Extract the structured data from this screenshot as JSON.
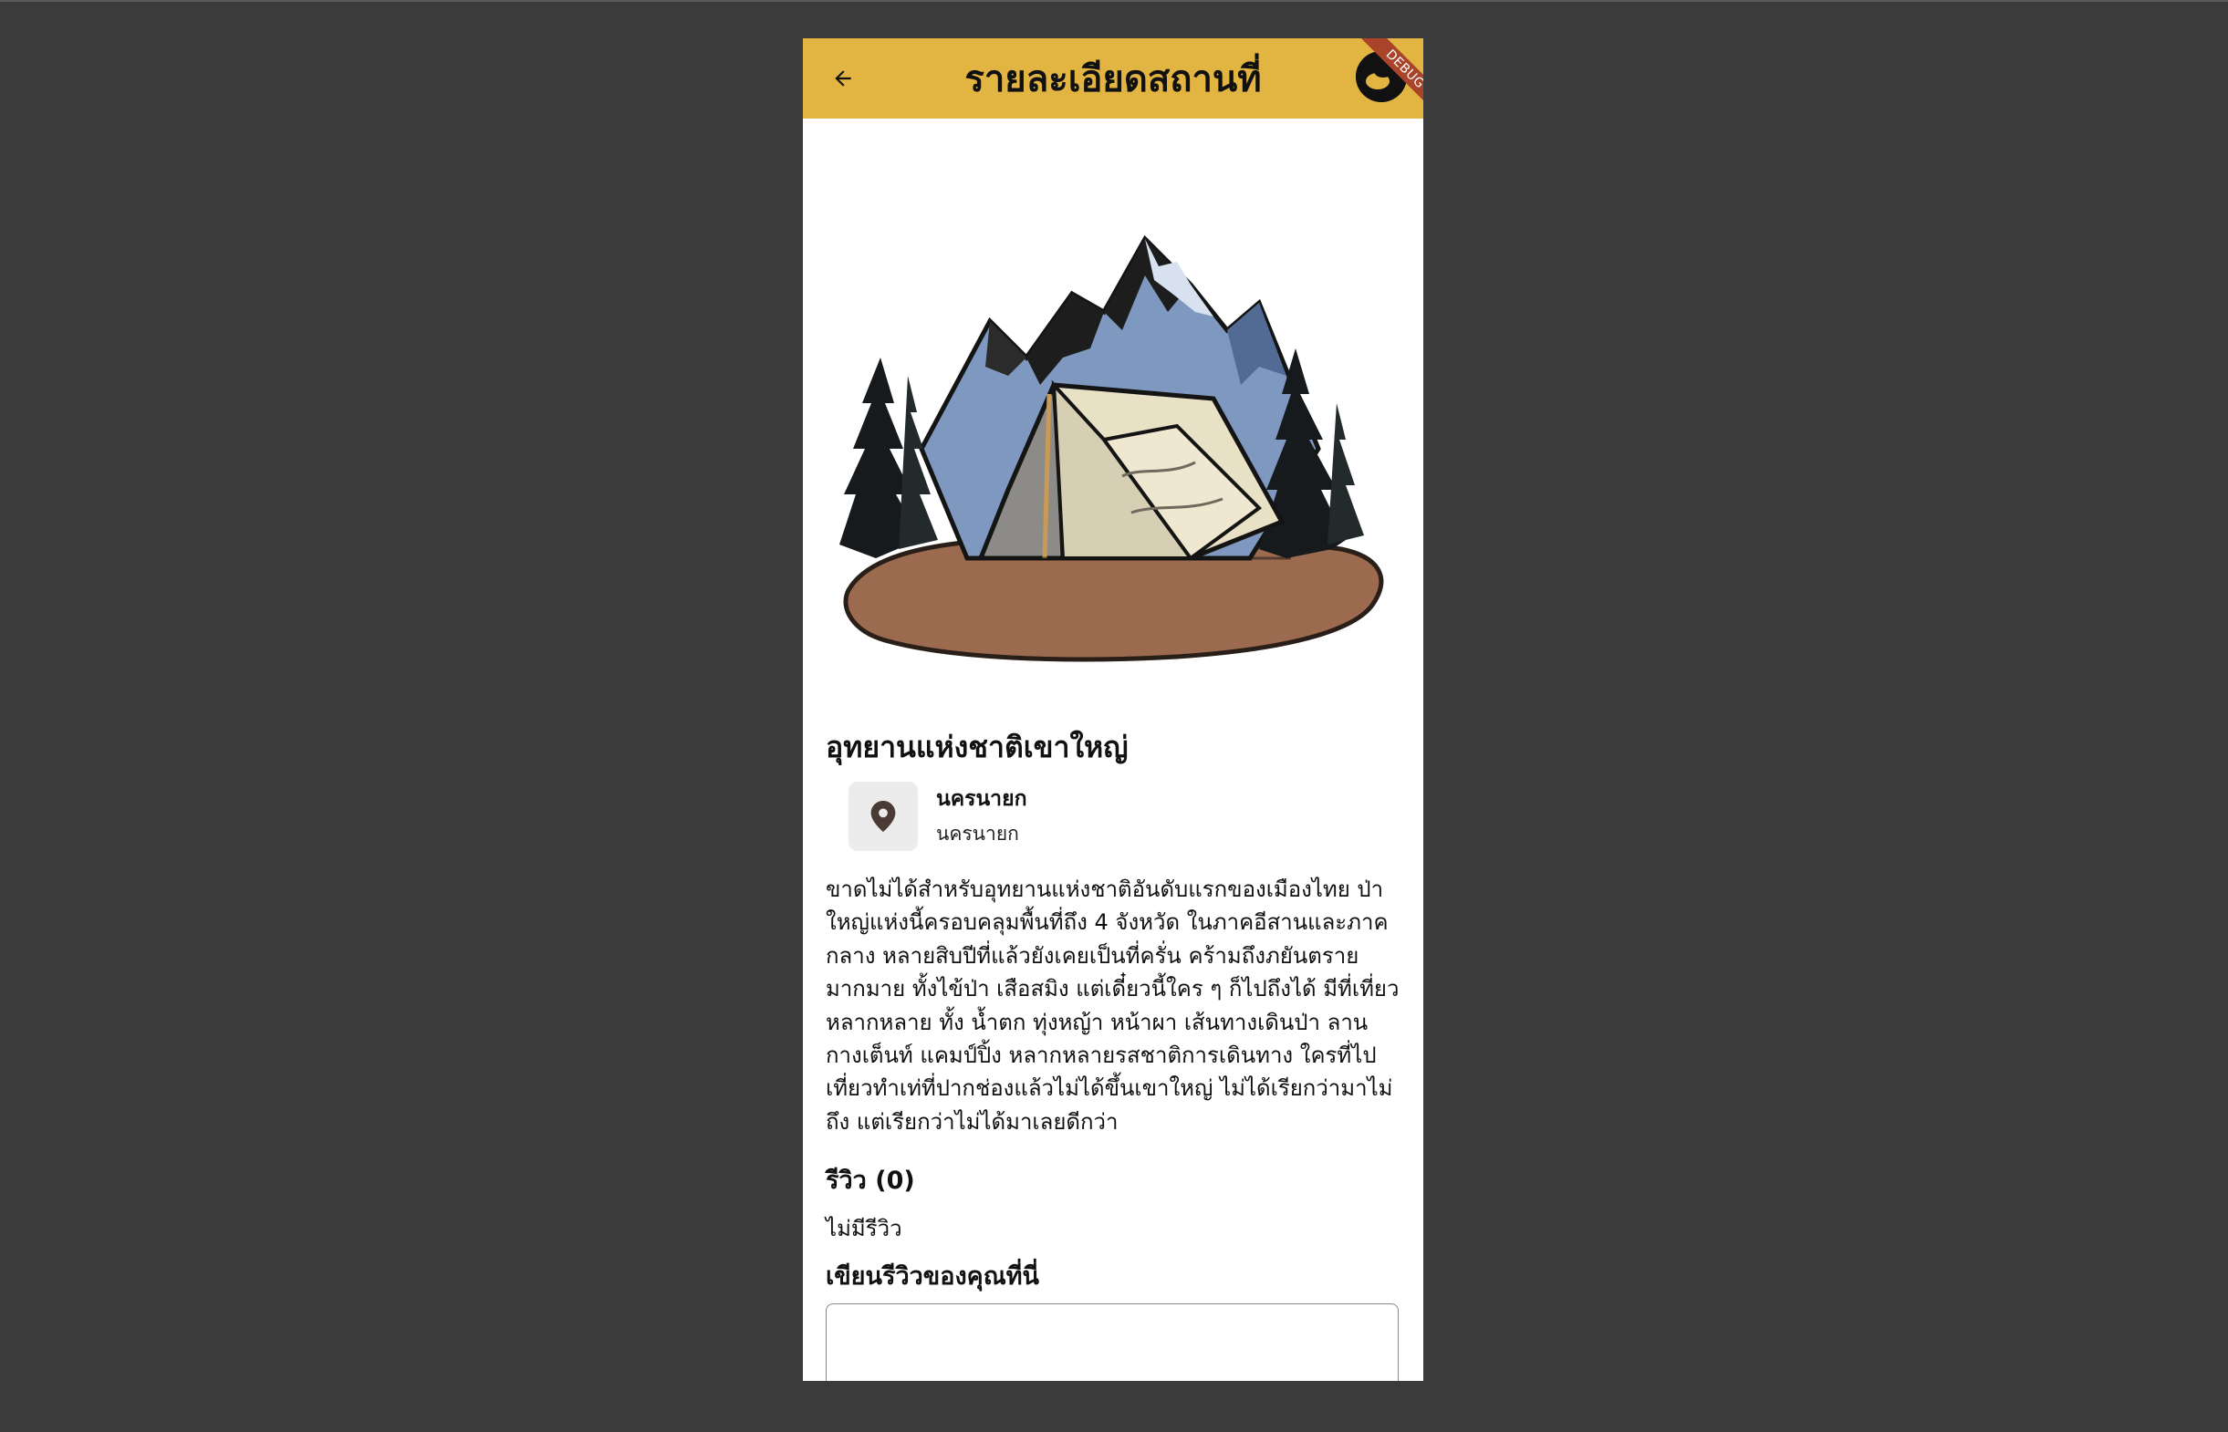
{
  "appbar": {
    "title": "รายละเอียดสถานที่",
    "back_icon": "arrow-left-icon",
    "debug_label": "DEBUG",
    "color": "#e2b441"
  },
  "place": {
    "name": "อุทยานแห่งชาติเขาใหญ่",
    "location_name": "นครนายก",
    "location_sub": "นครนายก",
    "location_icon": "map-pin-icon",
    "description": " ขาดไม่ได้สำหรับอุทยานแห่งชาติอันดับแรกของเมืองไทย ป่าใหญ่แห่งนี้ครอบคลุมพื้นที่ถึง 4 จังหวัด ในภาคอีสานและภาคกลาง หลายสิบปีที่แล้วยังเคยเป็นที่ครั่น คร้ามถึงภยันตรายมากมาย ทั้งไข้ป่า เสือสมิง แต่เดี๋ยวนี้ใคร ๆ ก็ไปถึงได้ มีที่เที่ยวหลากหลาย ทั้ง น้ำตก ทุ่งหญ้า หน้าผา เส้นทางเดินป่า ลานกางเต็นท์ แคมป์ปิ้ง หลากหลายรสชาติการเดินทาง ใครที่ไปเที่ยวทำเท่ที่ปากช่องแล้วไม่ได้ขึ้นเขาใหญ่ ไม่ได้เรียกว่ามาไม่ถึง แต่เรียกว่าไม่ได้มาเลยดีกว่า"
  },
  "reviews": {
    "heading": "รีวิว (0)",
    "empty_text": "ไม่มีรีวิว",
    "write_heading": "เขียนรีวิวของคุณที่นี่",
    "input_value": "",
    "input_placeholder": ""
  }
}
